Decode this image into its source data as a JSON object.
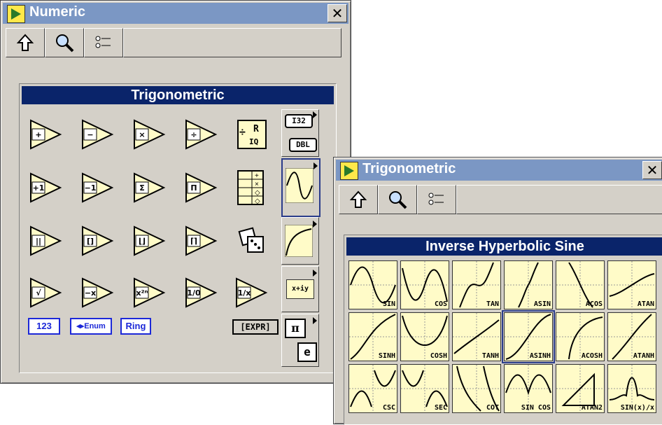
{
  "numeric_window": {
    "title": "Numeric",
    "header": "Trigonometric",
    "tools": [
      "up-arrow-icon",
      "search-icon",
      "options-icon"
    ],
    "controls": [
      "123",
      "◂▸Enum",
      "Ring"
    ],
    "expr": "[EXPR]",
    "subcats": {
      "i32": "I32",
      "dbl": "DBL",
      "pi": "π",
      "e": "e",
      "complex": "x+iy"
    }
  },
  "trig_window": {
    "title": "Trigonometric",
    "header": "Inverse Hyperbolic Sine",
    "graphs": [
      "SIN",
      "COS",
      "TAN",
      "ASIN",
      "ACOS",
      "ATAN",
      "SINH",
      "COSH",
      "TANH",
      "ASINH",
      "ACOSH",
      "ATANH",
      "CSC",
      "SEC",
      "COT",
      "SIN COS",
      "ATAN2",
      "SIN(x)/x"
    ]
  }
}
